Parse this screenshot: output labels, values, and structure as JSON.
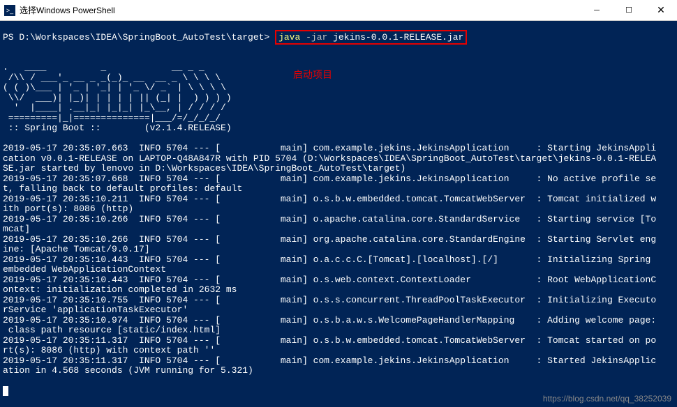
{
  "titlebar": {
    "icon_text": ">_",
    "title": "选择Windows PowerShell"
  },
  "prompt": {
    "path": "PS D:\\Workspaces\\IDEA\\SpringBoot_AutoTest\\target> ",
    "cmd_java": "java ",
    "cmd_flag": "-jar ",
    "cmd_arg": "jekins-0.0.1-RELEASE.jar"
  },
  "annotation": "启动项目",
  "ascii": ".   ____          _            __ _ _\n /\\\\ / ___'_ __ _ _(_)_ __  __ _ \\ \\ \\ \\\n( ( )\\___ | '_ | '_| | '_ \\/ _` | \\ \\ \\ \\\n \\\\/  ___)| |_)| | | | | || (_| |  ) ) ) )\n  '  |____| .__|_| |_|_| |_\\__, | / / / /\n =========|_|==============|___/=/_/_/_/",
  "spring_boot": " :: Spring Boot ::        (v2.1.4.RELEASE)",
  "logs": [
    "2019-05-17 20:35:07.663  INFO 5704 --- [           main] com.example.jekins.JekinsApplication     : Starting JekinsAppli",
    "cation v0.0.1-RELEASE on LAPTOP-Q48A847R with PID 5704 (D:\\Workspaces\\IDEA\\SpringBoot_AutoTest\\target\\jekins-0.0.1-RELEA",
    "SE.jar started by lenovo in D:\\Workspaces\\IDEA\\SpringBoot_AutoTest\\target)",
    "2019-05-17 20:35:07.668  INFO 5704 --- [           main] com.example.jekins.JekinsApplication     : No active profile se",
    "t, falling back to default profiles: default",
    "2019-05-17 20:35:10.211  INFO 5704 --- [           main] o.s.b.w.embedded.tomcat.TomcatWebServer  : Tomcat initialized w",
    "ith port(s): 8086 (http)",
    "2019-05-17 20:35:10.266  INFO 5704 --- [           main] o.apache.catalina.core.StandardService   : Starting service [To",
    "mcat]",
    "2019-05-17 20:35:10.266  INFO 5704 --- [           main] org.apache.catalina.core.StandardEngine  : Starting Servlet eng",
    "ine: [Apache Tomcat/9.0.17]",
    "2019-05-17 20:35:10.443  INFO 5704 --- [           main] o.a.c.c.C.[Tomcat].[localhost].[/]       : Initializing Spring",
    "embedded WebApplicationContext",
    "2019-05-17 20:35:10.443  INFO 5704 --- [           main] o.s.web.context.ContextLoader            : Root WebApplicationC",
    "ontext: initialization completed in 2632 ms",
    "2019-05-17 20:35:10.755  INFO 5704 --- [           main] o.s.s.concurrent.ThreadPoolTaskExecutor  : Initializing Executo",
    "rService 'applicationTaskExecutor'",
    "2019-05-17 20:35:10.974  INFO 5704 --- [           main] o.s.b.a.w.s.WelcomePageHandlerMapping    : Adding welcome page:",
    " class path resource [static/index.html]",
    "2019-05-17 20:35:11.317  INFO 5704 --- [           main] o.s.b.w.embedded.tomcat.TomcatWebServer  : Tomcat started on po",
    "rt(s): 8086 (http) with context path ''",
    "2019-05-17 20:35:11.317  INFO 5704 --- [           main] com.example.jekins.JekinsApplication     : Started JekinsApplic",
    "ation in 4.568 seconds (JVM running for 5.321)"
  ],
  "watermark": "https://blog.csdn.net/qq_38252039"
}
